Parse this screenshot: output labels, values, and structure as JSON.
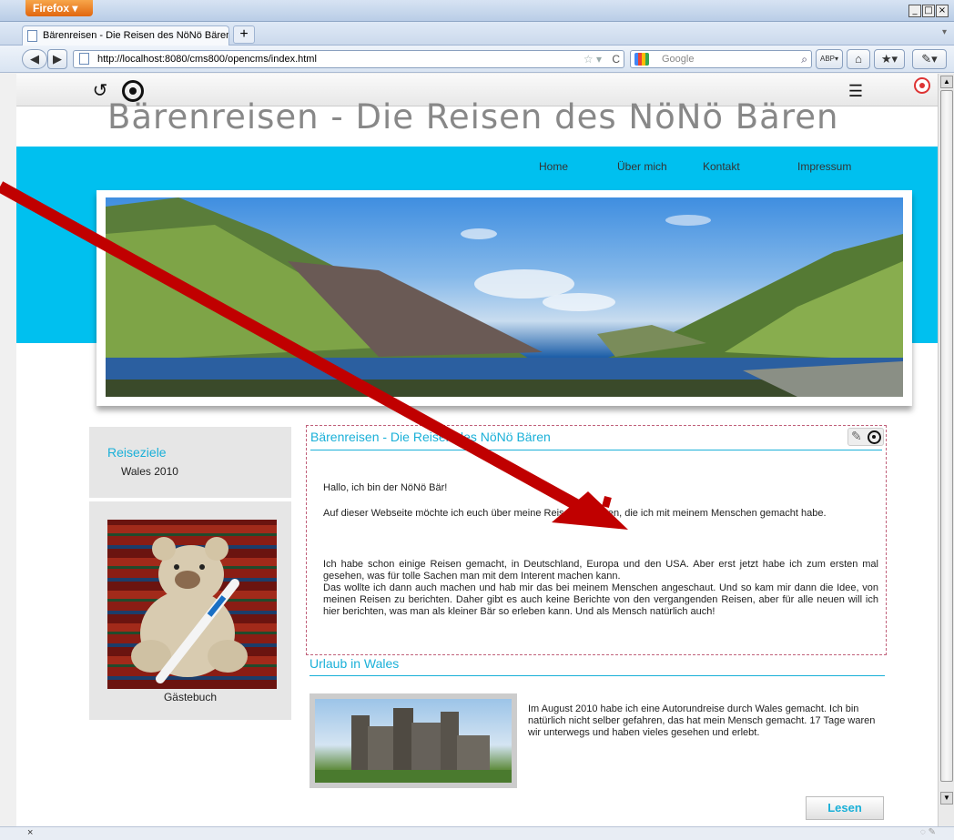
{
  "browser": {
    "app_button": "Firefox",
    "tab_title": "Bärenreisen - Die Reisen des NöNö Bären",
    "new_tab": "+",
    "url": "http://localhost:8080/cms800/opencms/index.html",
    "search_placeholder": "Google",
    "window_controls": [
      "_",
      "□",
      "×"
    ],
    "status_text": "×"
  },
  "icons": {
    "history": "history-icon",
    "target": "target-icon",
    "list": "list-icon",
    "publish": "publish-icon",
    "pencil": "pencil-icon"
  },
  "site": {
    "title": "Bärenreisen - Die Reisen des NöNö Bären",
    "nav": [
      {
        "label": "Home"
      },
      {
        "label": "Über mich"
      },
      {
        "label": "Kontakt"
      },
      {
        "label": "Impressum"
      }
    ],
    "accent_color": "#00c0ef"
  },
  "sidebar": {
    "heading": "Reiseziele",
    "link": "Wales 2010",
    "guestbook_label": "Gästebuch"
  },
  "content": {
    "title": "Bärenreisen - Die Reisen des NöNö Bären",
    "paragraphs": [
      "Hallo, ich bin der NöNö Bär!",
      "Auf dieser Webseite möchte ich euch über meine Reisen berichten, die ich mit meinem Menschen gemacht habe.",
      "Ich habe schon einige Reisen gemacht, in Deutschland, Europa und den USA. Aber erst jetzt habe ich zum ersten mal gesehen, was für tolle Sachen man mit dem Interent machen kann.",
      "Das wollte ich dann auch machen und hab mir das bei meinem Menschen angeschaut. Und so kam mir dann die Idee, von meinen Reisen zu berichten. Daher gibt es auch keine Berichte von den vergangenden Reisen, aber für alle neuen will ich hier berichten, was man als kleiner Bär so erleben kann. Und als Mensch natürlich auch!"
    ]
  },
  "article": {
    "title": "Urlaub in Wales",
    "text": "Im August 2010 habe ich eine Autorundreise durch Wales gemacht. Ich bin natürlich nicht selber gefahren, das hat mein Mensch gemacht. 17 Tage waren wir unterwegs und haben vieles gesehen und erlebt.",
    "button": "Lesen"
  }
}
